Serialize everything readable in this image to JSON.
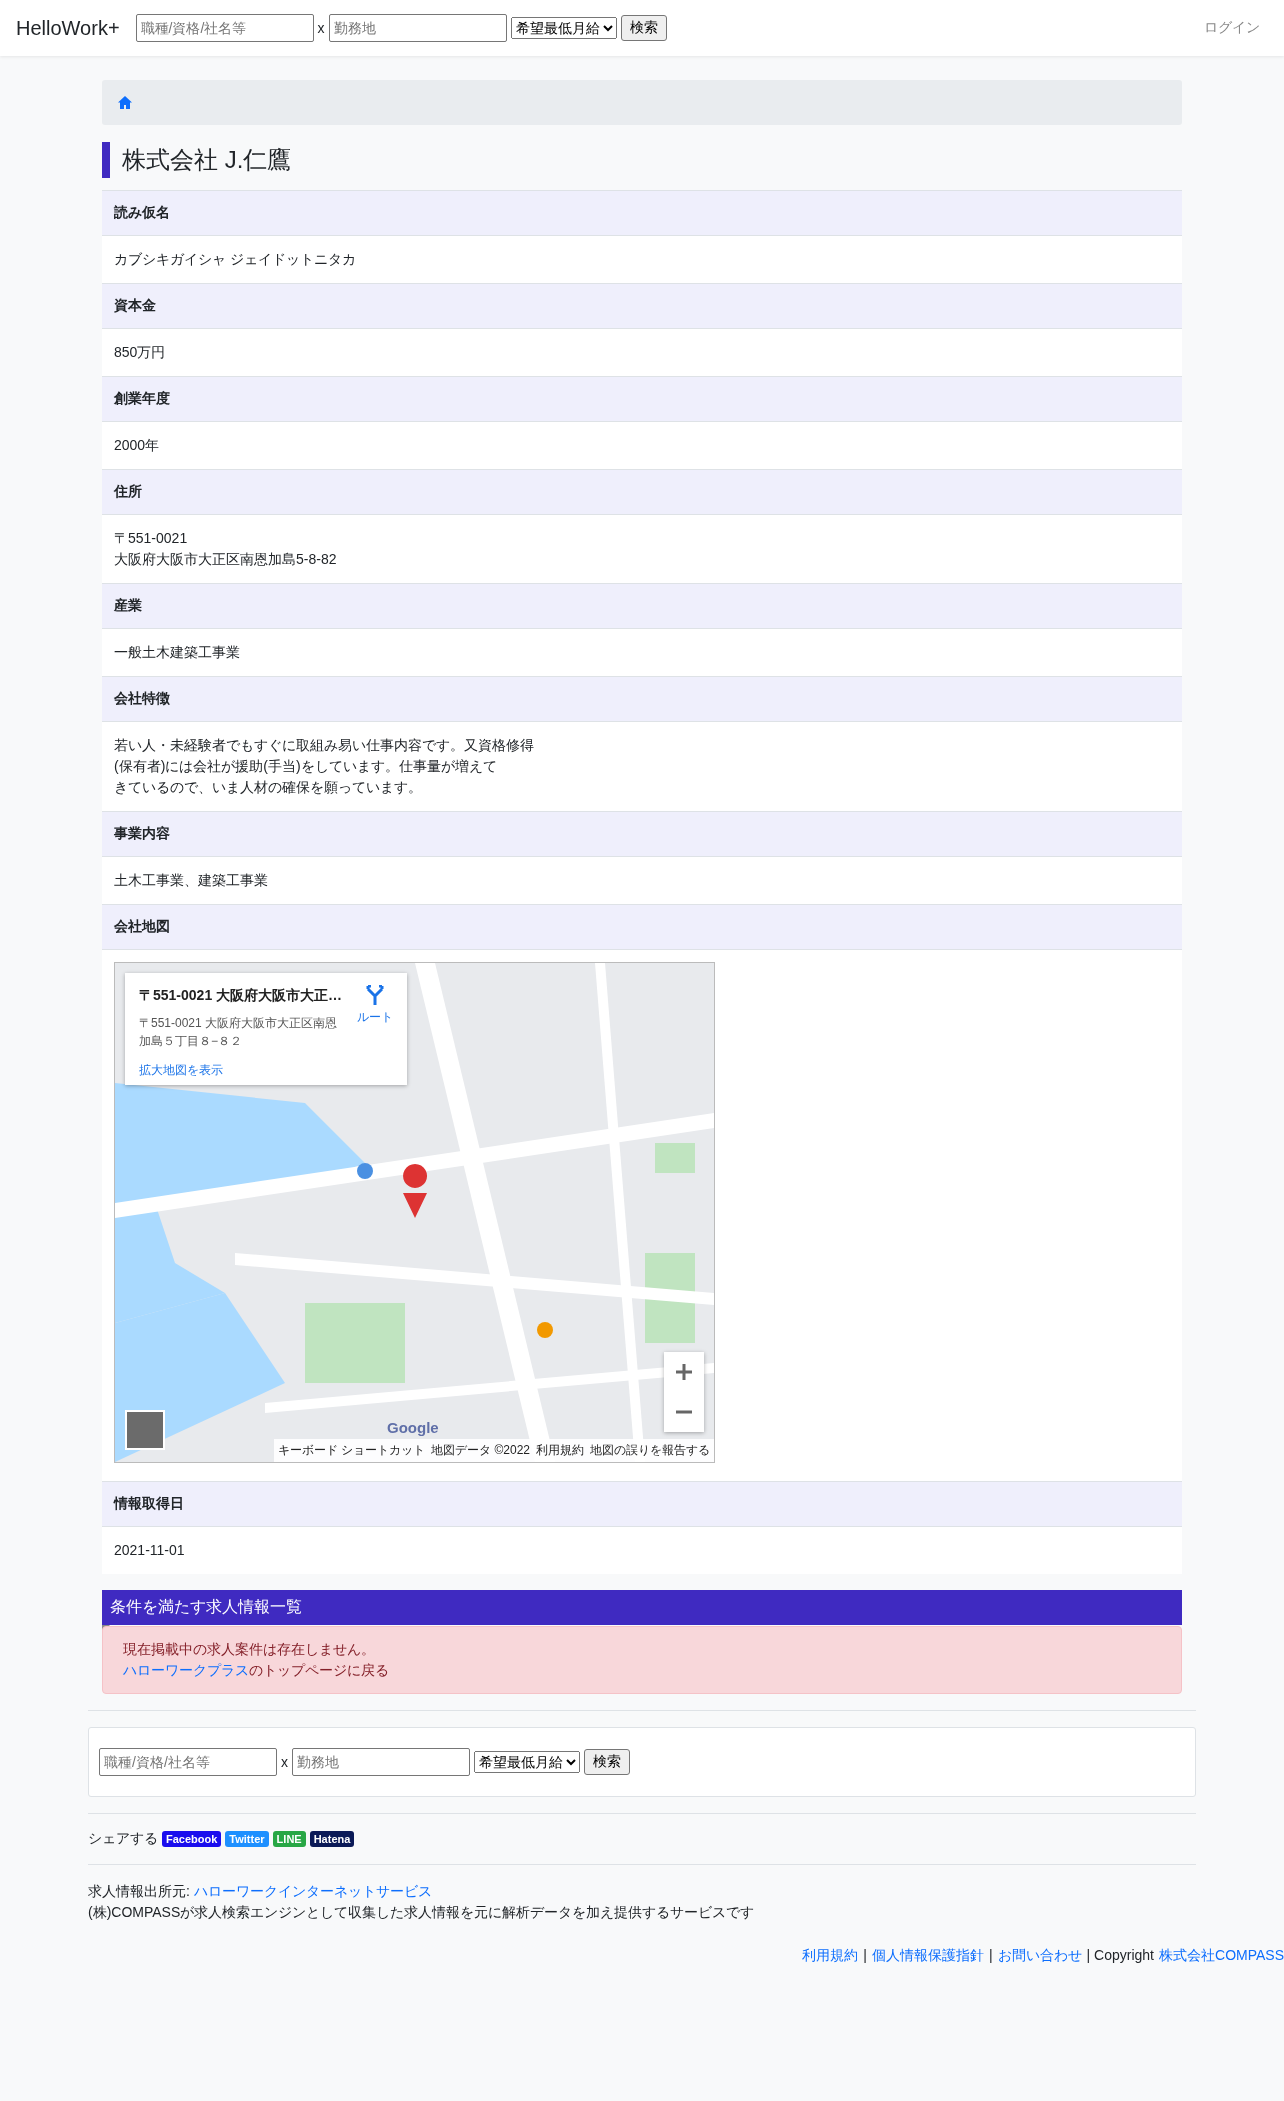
{
  "header": {
    "brand": "HelloWork+",
    "search": {
      "keyword_placeholder": "職種/資格/社名等",
      "separator": "x",
      "location_placeholder": "勤務地",
      "salary_select": "希望最低月給",
      "button": "検索"
    },
    "login": "ログイン"
  },
  "company_name": "株式会社 J.仁鷹",
  "fields": [
    {
      "kind": "text",
      "label": "読み仮名",
      "lines": [
        "カブシキガイシャ ジェイドットニタカ"
      ]
    },
    {
      "kind": "text",
      "label": "資本金",
      "lines": [
        "850万円"
      ]
    },
    {
      "kind": "text",
      "label": "創業年度",
      "lines": [
        "2000年"
      ]
    },
    {
      "kind": "text",
      "label": "住所",
      "lines": [
        "〒551-0021",
        "大阪府大阪市大正区南恩加島5-8-82"
      ]
    },
    {
      "kind": "text",
      "label": "産業",
      "lines": [
        "一般土木建築工事業"
      ]
    },
    {
      "kind": "text",
      "label": "会社特徴",
      "lines": [
        "若い人・未経験者でもすぐに取組み易い仕事内容です。又資格修得",
        "(保有者)には会社が援助(手当)をしています。仕事量が増えて",
        "きているので、いま人材の確保を願っています。"
      ]
    },
    {
      "kind": "text",
      "label": "事業内容",
      "lines": [
        "土木工事業、建築工事業"
      ]
    },
    {
      "kind": "map",
      "label": "会社地図",
      "map": {
        "popup_title": "〒551-0021 大阪府大阪市大正…",
        "popup_address": "〒551-0021 大阪府大阪市大正区南恩加島５丁目８−８２",
        "route": "ルート",
        "enlarge_link": "拡大地図を表示",
        "logo": "Google",
        "footer_links": [
          "キーボード ショートカット",
          "地図データ ©2022",
          "利用規約",
          "地図の誤りを報告する"
        ]
      }
    },
    {
      "kind": "text",
      "label": "情報取得日",
      "lines": [
        "2021-11-01"
      ]
    }
  ],
  "jobs_section": {
    "title": "条件を満たす求人情報一覧",
    "message": "現在掲載中の求人案件は存在しません。",
    "link": "ハローワークプラス",
    "link_suffix": "のトップページに戻る"
  },
  "bottom_search": {
    "keyword_placeholder": "職種/資格/社名等",
    "separator": "x",
    "location_placeholder": "勤務地",
    "salary_select": "希望最低月給",
    "button": "検索"
  },
  "share": {
    "label": "シェアする",
    "buttons": [
      {
        "label": "Facebook",
        "color": "#1a0dee"
      },
      {
        "label": "Twitter",
        "color": "#1e90ff"
      },
      {
        "label": "LINE",
        "color": "#28a745"
      },
      {
        "label": "Hatena",
        "color": "#0b1a57"
      }
    ]
  },
  "source": {
    "label": "求人情報出所元: ",
    "link": "ハローワークインターネットサービス"
  },
  "description": "(株)COMPASSが求人検索エンジンとして収集した求人情報を元に解析データを加え提供するサービスです",
  "footer": [
    {
      "kind": "link",
      "text": "利用規約"
    },
    {
      "kind": "text",
      "text": "|"
    },
    {
      "kind": "link",
      "text": "個人情報保護指針"
    },
    {
      "kind": "text",
      "text": "|"
    },
    {
      "kind": "link",
      "text": "お問い合わせ"
    },
    {
      "kind": "text",
      "text": "| Copyright"
    },
    {
      "kind": "link",
      "text": "株式会社COMPASS"
    }
  ]
}
